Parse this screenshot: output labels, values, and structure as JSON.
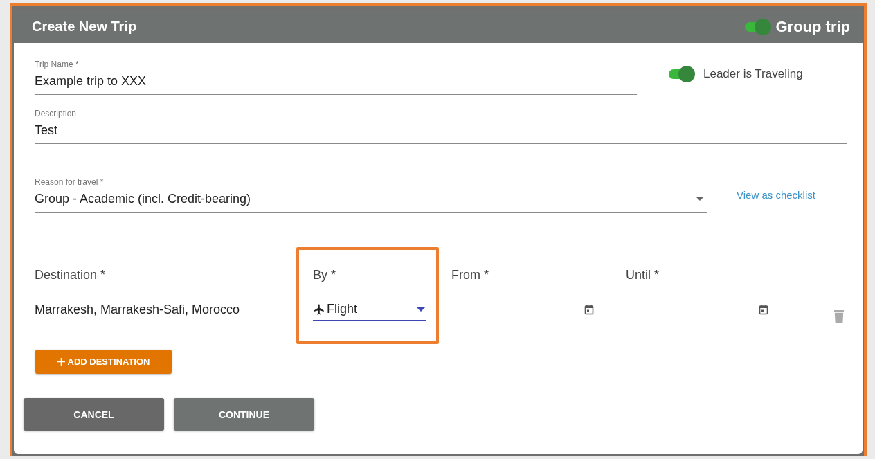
{
  "dialog": {
    "title": "Create New Trip",
    "group_trip": {
      "label": "Group trip",
      "on": true
    }
  },
  "trip_name": {
    "label": "Trip Name *",
    "value": "Example trip to XXX"
  },
  "leader_traveling": {
    "label": "Leader is Traveling",
    "on": true
  },
  "description": {
    "label": "Description",
    "value": "Test"
  },
  "reason": {
    "label": "Reason for travel *",
    "value": "Group - Academic (incl. Credit-bearing)"
  },
  "checklist_link": "View as checklist",
  "destinations": [
    {
      "destination": {
        "label": "Destination *",
        "value": "Marrakesh, Marrakesh-Safi, Morocco"
      },
      "by": {
        "label": "By *",
        "value": "Flight",
        "focused": true,
        "highlighted": true
      },
      "from": {
        "label": "From *"
      },
      "until": {
        "label": "Until *"
      }
    }
  ],
  "add_button": "ADD DESTINATION",
  "buttons": [
    {
      "label": "CANCEL",
      "kind": "cancel"
    },
    {
      "label": "CONTINUE",
      "kind": "continue"
    }
  ]
}
